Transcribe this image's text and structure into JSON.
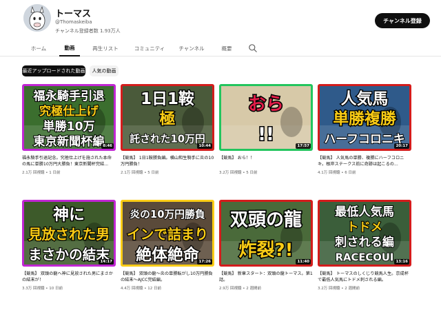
{
  "channel": {
    "name": "トーマス",
    "handle": "@Thomaskeiba",
    "subscribers": "チャンネル登録者数 1.93万人",
    "subscribe_label": "チャンネル登録"
  },
  "tabs": [
    {
      "label": "ホーム",
      "active": false
    },
    {
      "label": "動画",
      "active": true
    },
    {
      "label": "再生リスト",
      "active": false
    },
    {
      "label": "コミュニティ",
      "active": false
    },
    {
      "label": "チャンネル",
      "active": false
    },
    {
      "label": "概要",
      "active": false
    }
  ],
  "chips": [
    {
      "label": "最近アップロードされた動画",
      "selected": true
    },
    {
      "label": "人気の動画",
      "selected": false
    }
  ],
  "videos": [
    {
      "duration": "8:46",
      "title": "福永騎手引退記念。究極仕上げを施された本命の馬に単勝10万円大勝負！東京新聞杯完結...",
      "meta": "2.1万 回視聴 • 1 日前",
      "thumb_text": [
        "福永騎手引退",
        "究極仕上げ",
        "単勝10万",
        "東京新聞杯編"
      ],
      "colors": {
        "border": "#c026d3",
        "bg": "#3b6e2e",
        "main": "#ffffff",
        "accent": "#facc15"
      }
    },
    {
      "duration": "10:44",
      "title": "【競馬】 1日1鞍勝負編。横山和生騎手に炎の10万円勝負！",
      "meta": "2.1万 回視聴 • 5 日前",
      "thumb_text": [
        "1日1鞍",
        "極",
        "託された10万円"
      ],
      "colors": {
        "border": "#d41c1c",
        "bg": "#4a5a3a",
        "main": "#ffffff",
        "accent": "#facc15"
      }
    },
    {
      "duration": "17:57",
      "title": "【競馬】 おら！！",
      "meta": "3.2万 回視聴 • 5 日前",
      "thumb_text": [
        "おら",
        "!!"
      ],
      "colors": {
        "border": "#22c55e",
        "bg": "#d7c9a8",
        "main": "#e11d48",
        "accent": "#ffffff"
      }
    },
    {
      "duration": "20:17",
      "title": "【競馬】 人気馬の単勝、複勝にハーフコロニキ。根岸ステークス前に奇跡は起こるの...",
      "meta": "4.1万 回視聴 • 6 日前",
      "thumb_text": [
        "人気馬",
        "単勝複勝",
        "ハーフコロニキ"
      ],
      "colors": {
        "border": "#d41c1c",
        "bg": "#2f5a8a",
        "main": "#ffffff",
        "accent": "#facc15"
      }
    },
    {
      "duration": "14:17",
      "title": "【競馬】 双頭の龍へ神に見放された男にまさかの結末が！",
      "meta": "3.3万 回視聴 • 10 日前",
      "thumb_text": [
        "神に",
        "見放された男",
        "まさかの結末"
      ],
      "colors": {
        "border": "#c026d3",
        "bg": "#3d5a2a",
        "main": "#ffffff",
        "accent": "#facc15"
      }
    },
    {
      "duration": "17:26",
      "title": "【競馬】 双頭の龍～炎の単勝転がし10万円勝負の結末～AJCC完結編。",
      "meta": "4.4万 回視聴 • 12 日前",
      "thumb_text": [
        "炎の10万円勝負",
        "インで詰まり",
        "絶体絶命"
      ],
      "colors": {
        "border": "#facc15",
        "bg": "#5a4a3a",
        "main": "#ffffff",
        "accent": "#facc15"
      }
    },
    {
      "duration": "11:40",
      "title": "【競馬】 新章スタート：双頭の龍トーマス。第1話。",
      "meta": "2.9万 回視聴 • 2 週間前",
      "thumb_text": [
        "双頭の龍",
        "炸裂?!"
      ],
      "colors": {
        "border": "#d41c1c",
        "bg": "#4a6a3a",
        "main": "#ffffff",
        "accent": "#facc15"
      }
    },
    {
      "duration": "13:16",
      "title": "【競馬】 トーマスのしくじり競馬人生。京成杯で最低人気馬にトドメ刺される編。",
      "meta": "3.2万 回視聴 • 2 週間前",
      "thumb_text": [
        "最低人気馬",
        "トドメ",
        "刺される編",
        "RACECOUI"
      ],
      "colors": {
        "border": "#d41c1c",
        "bg": "#3b5e3a",
        "main": "#ffffff",
        "accent": "#facc15"
      }
    }
  ]
}
